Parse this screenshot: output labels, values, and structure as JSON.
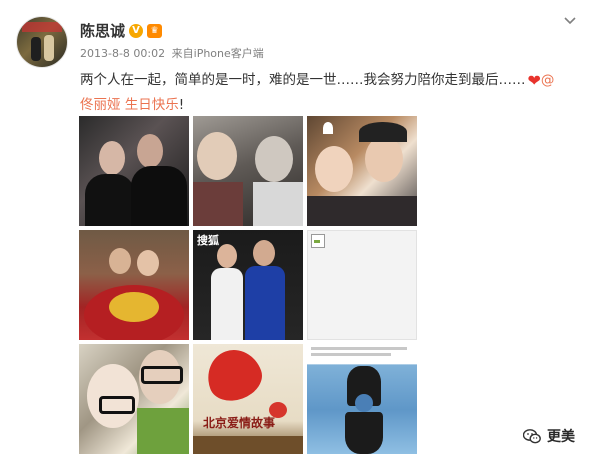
{
  "user": {
    "name": "陈思诚",
    "verified_badge": "V",
    "member_badge": "♛"
  },
  "meta": {
    "time": "2013-8-8 00:02",
    "source_prefix": "来自",
    "source": "iPhone客户端"
  },
  "post": {
    "text": "两个人在一起，简单的是一时，难的是一世……我会努力陪你走到最后……",
    "heart": "❤",
    "mention": "@佟丽娅",
    "tag": "生日快乐",
    "end": "!"
  },
  "photos": {
    "c5_logo_top": "搜狐",
    "c8_title": "北京爱情故事"
  },
  "footer": {
    "label": "更美"
  },
  "icons": {
    "expand": "chevron-down-icon",
    "wechat": "wechat-icon"
  },
  "colors": {
    "link": "#eb7350",
    "verified": "#f7a700",
    "heart": "#e8332c",
    "meta": "#808080"
  }
}
